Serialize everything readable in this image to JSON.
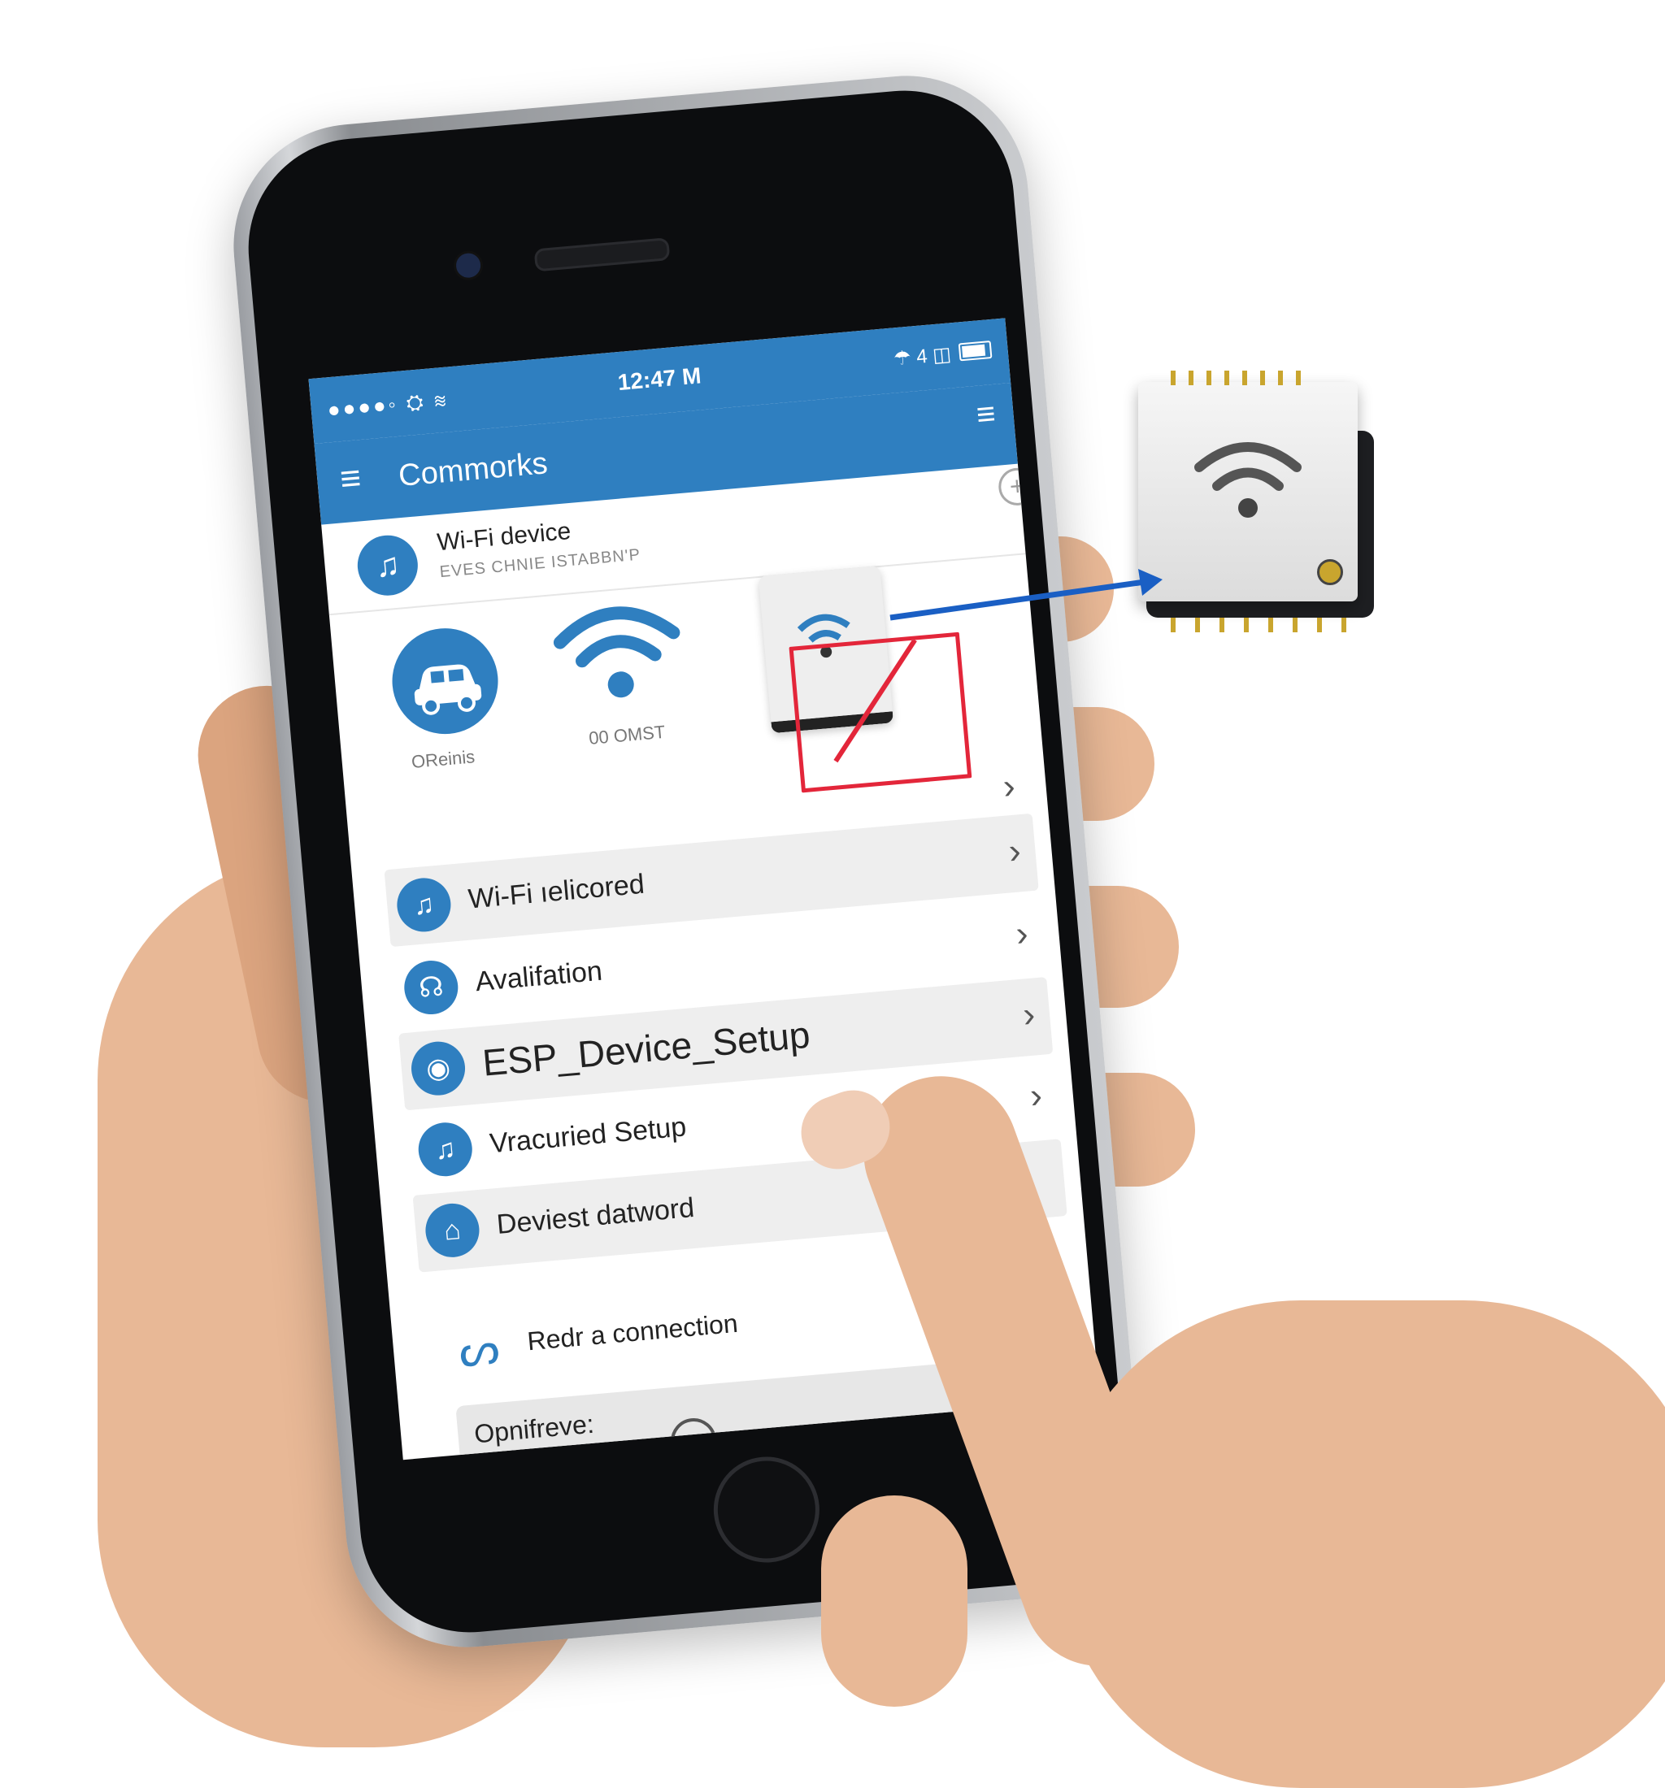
{
  "statusbar": {
    "signal": "●●●●◦ ⛭ ≋",
    "time": "12:47 M",
    "right_icons": "☂ 4 ◫"
  },
  "appbar": {
    "menu_icon": "menu-icon",
    "title": "Commorks",
    "add_icon": "plus-circle-icon"
  },
  "device_header": {
    "title": "Wi-Fi device",
    "subtitle": "EVES CHNIE ISTABBN'P"
  },
  "quick": {
    "car_label": "OReinis",
    "wifi_label": "00 OMST"
  },
  "rows": [
    {
      "label": "Wi-Fi ıelicored",
      "icon": "♫"
    },
    {
      "label": "Avalifation",
      "icon": "☊"
    },
    {
      "label": "ESP_Device_Setup",
      "icon": "◉"
    },
    {
      "label": "Vracuried Setup",
      "icon": "♫"
    },
    {
      "label": "Deviest datword",
      "icon": "⌂"
    }
  ],
  "reconnect": {
    "label": "Redr a connection"
  },
  "options": {
    "label": "Opnifreve:"
  },
  "colors": {
    "accent": "#2f7fc0",
    "highlight": "#e3263a",
    "connector": "#1a5fc4"
  }
}
